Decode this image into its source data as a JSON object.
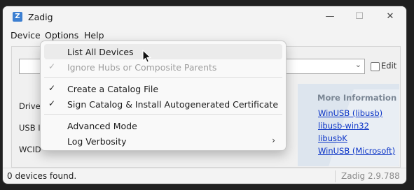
{
  "window": {
    "title": "Zadig",
    "app_icon_glyph": "Z",
    "minimize_glyph": "—",
    "maximize_glyph": "☐",
    "close_glyph": "✕"
  },
  "menubar": {
    "items": [
      "Device",
      "Options",
      "Help"
    ]
  },
  "main": {
    "edit_label": "Edit",
    "combo_arrow": "⌄",
    "labels": {
      "driver": "Driver",
      "usb_id": "USB ID",
      "wcid": "WCID"
    }
  },
  "info_panel": {
    "title": "More Information",
    "links": [
      "WinUSB (libusb)",
      "libusb-win32",
      "libusbK",
      "WinUSB (Microsoft)"
    ]
  },
  "status": {
    "text": "0 devices found.",
    "version": "Zadig 2.9.788"
  },
  "options_menu": {
    "items": [
      {
        "label": "List All Devices",
        "checked": false,
        "disabled": false,
        "highlighted": true
      },
      {
        "label": "Ignore Hubs or Composite Parents",
        "checked": true,
        "disabled": true
      },
      {
        "label": "Create a Catalog File",
        "checked": true,
        "disabled": false
      },
      {
        "label": "Sign Catalog & Install Autogenerated Certificate",
        "checked": true,
        "disabled": false
      },
      {
        "label": "Advanced Mode",
        "checked": false,
        "disabled": false
      },
      {
        "label": "Log Verbosity",
        "checked": false,
        "disabled": false,
        "submenu": true
      }
    ],
    "check_glyph": "✓",
    "submenu_glyph": "›"
  }
}
